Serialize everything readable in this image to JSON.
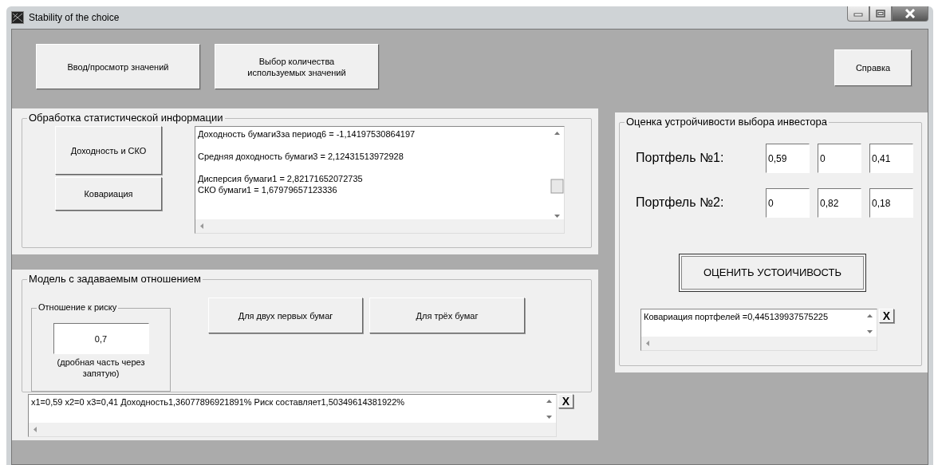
{
  "window": {
    "title": "Stability of the choice"
  },
  "top_buttons": [
    "Ввод/просмотр значений",
    "Выбор количества используемых значений"
  ],
  "help_button": "Справка",
  "stats": {
    "title": "Обработка статистической информации",
    "buttons": [
      "Доходность и СКО",
      "Ковариация"
    ],
    "output": [
      [
        "Доходность бумаги3за период6 =  -1,14197530864197"
      ],
      [
        "Средняя доходность бумаги3 =  2,12431513972928"
      ],
      [
        "Дисперсия бумаги1 = 2,82171652072735",
        "СКО бумаги1 = 1,67979657123336"
      ]
    ]
  },
  "model": {
    "title": "Модель с задаваемым отношением",
    "risk": {
      "title": "Отношение к риску",
      "value": "0,7",
      "note": "(дробная часть через запятую)"
    },
    "buttons": [
      "Для двух первых бумаг",
      "Для трёх бумаг"
    ],
    "output": "x1=0,59 x2=0  x3=0,41   Доходность1,36077896921891%    Риск составляет1,50349614381922%",
    "clear": "X"
  },
  "stability": {
    "title": "Оценка устройчивости выбора инвестора",
    "portfolios": [
      {
        "label": "Портфель №1:",
        "weights": [
          "0,59",
          "0",
          "0,41"
        ]
      },
      {
        "label": "Портфель №2:",
        "weights": [
          "0",
          "0,82",
          "0,18"
        ]
      }
    ],
    "button": "ОЦЕНИТЬ УСТОИЧИВОСТЬ",
    "output": "Ковариация портфелей =0,445139937575225",
    "clear": "X"
  }
}
